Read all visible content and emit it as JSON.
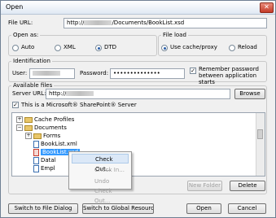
{
  "window": {
    "title": "Open",
    "close_glyph": "✕"
  },
  "file_url": {
    "label": "File URL:",
    "value_prefix": "http://",
    "value_suffix": "/Documents/BookList.xsd"
  },
  "open_as": {
    "label": "Open as:",
    "options": [
      "Auto",
      "XML",
      "DTD"
    ],
    "selected": "DTD"
  },
  "file_load": {
    "label": "File load",
    "options": [
      "Use cache/proxy",
      "Reload"
    ],
    "selected": "Use cache/proxy"
  },
  "identification": {
    "label": "Identification",
    "user_label": "User:",
    "password_label": "Password:",
    "password_value": "••••••••••••••",
    "remember_label": "Remember password between application starts",
    "remember_checked": true
  },
  "available_files": {
    "label": "Available files",
    "server_url_label": "Server URL:",
    "server_url_prefix": "http://",
    "browse_label": "Browse",
    "sharepoint_label": "This is a Microsoft® SharePoint® Server",
    "sharepoint_checked": true
  },
  "tree": {
    "nodes": [
      {
        "label": "Cache Profiles",
        "type": "folder",
        "expander": "+"
      },
      {
        "label": "Documents",
        "type": "folder",
        "expander": "−"
      },
      {
        "label": "Forms",
        "type": "folder",
        "expander": "+"
      },
      {
        "label": "BookList.xml",
        "type": "file"
      },
      {
        "label": "BookList.xsd",
        "type": "file",
        "selected": true
      },
      {
        "label": "Datal",
        "type": "file"
      },
      {
        "label": "Empl",
        "type": "file"
      }
    ]
  },
  "context_menu": {
    "items": [
      {
        "label": "Check Out...",
        "highlighted": true
      },
      {
        "label": "Check In...",
        "disabled": true
      },
      {
        "label": "Undo Check Out...",
        "disabled": true
      }
    ]
  },
  "buttons": {
    "new_folder": "New Folder",
    "delete": "Delete",
    "switch_file": "Switch to File Dialog",
    "switch_global": "Switch to Global Resources",
    "open": "Open",
    "cancel": "Cancel"
  }
}
